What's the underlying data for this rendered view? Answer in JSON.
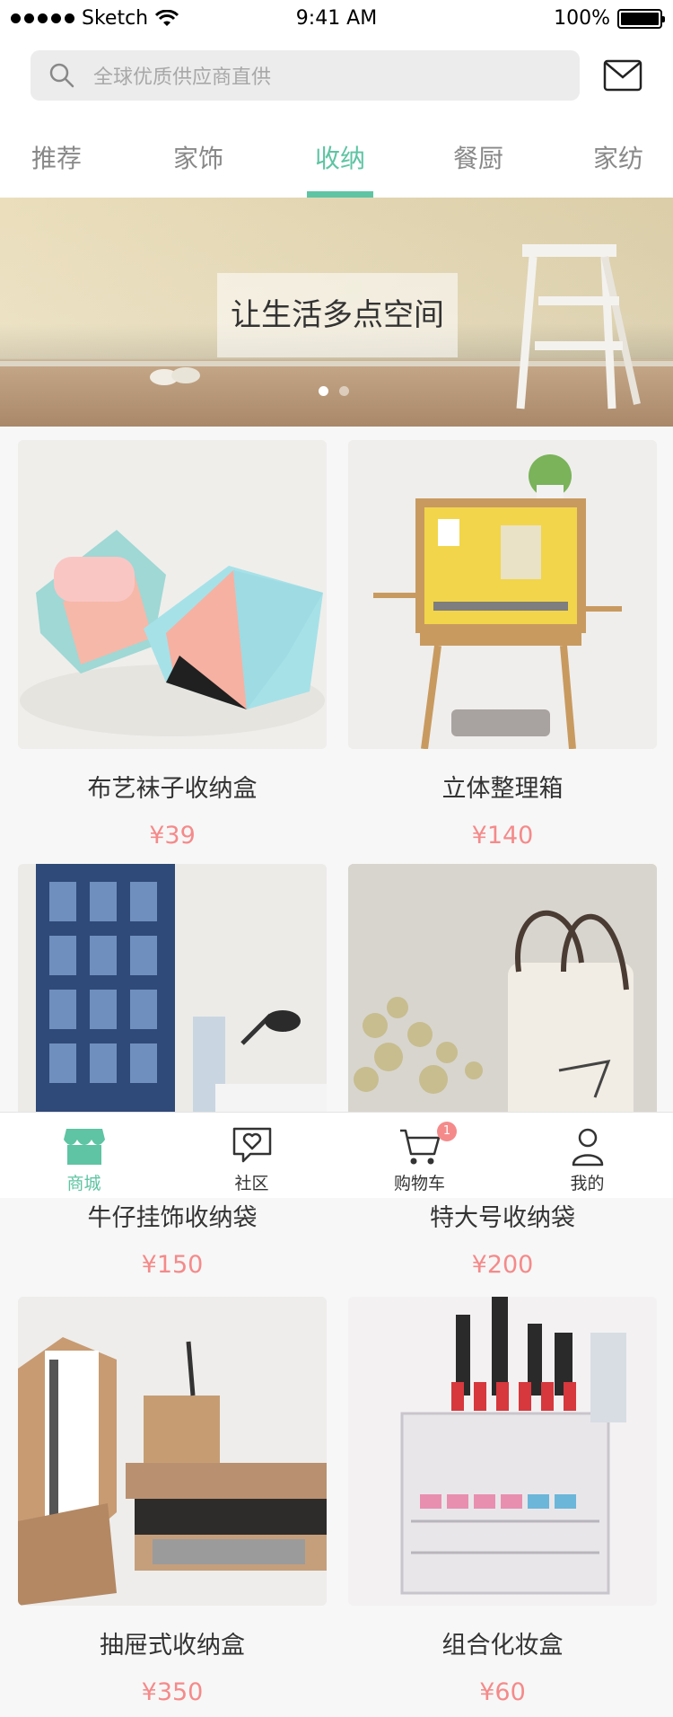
{
  "status_bar": {
    "carrier": "Sketch",
    "time": "9:41 AM",
    "battery": "100%"
  },
  "search": {
    "placeholder": "全球优质供应商直供"
  },
  "tabs": [
    {
      "label": "推荐"
    },
    {
      "label": "家饰"
    },
    {
      "label": "收纳"
    },
    {
      "label": "餐厨"
    },
    {
      "label": "家纺"
    }
  ],
  "active_tab": "收纳",
  "banner": {
    "caption": "让生活多点空间",
    "pages": 2,
    "current_page": 1
  },
  "products": [
    {
      "name": "布艺袜子收纳盒",
      "price": "¥39"
    },
    {
      "name": "立体整理箱",
      "price": "¥140"
    },
    {
      "name": "牛仔挂饰收纳袋",
      "price": "¥150"
    },
    {
      "name": "特大号收纳袋",
      "price": "¥200"
    },
    {
      "name": "抽屉式收纳盒",
      "price": "¥350"
    },
    {
      "name": "组合化妆盒",
      "price": "¥60"
    }
  ],
  "tabbar": {
    "items": [
      {
        "label": "商城",
        "icon": "store-icon"
      },
      {
        "label": "社区",
        "icon": "chat-heart-icon"
      },
      {
        "label": "购物车",
        "icon": "cart-icon"
      },
      {
        "label": "我的",
        "icon": "user-icon"
      }
    ],
    "cart_badge": "1"
  },
  "colors": {
    "accent": "#5ec4a3",
    "price": "#f58a8a"
  }
}
